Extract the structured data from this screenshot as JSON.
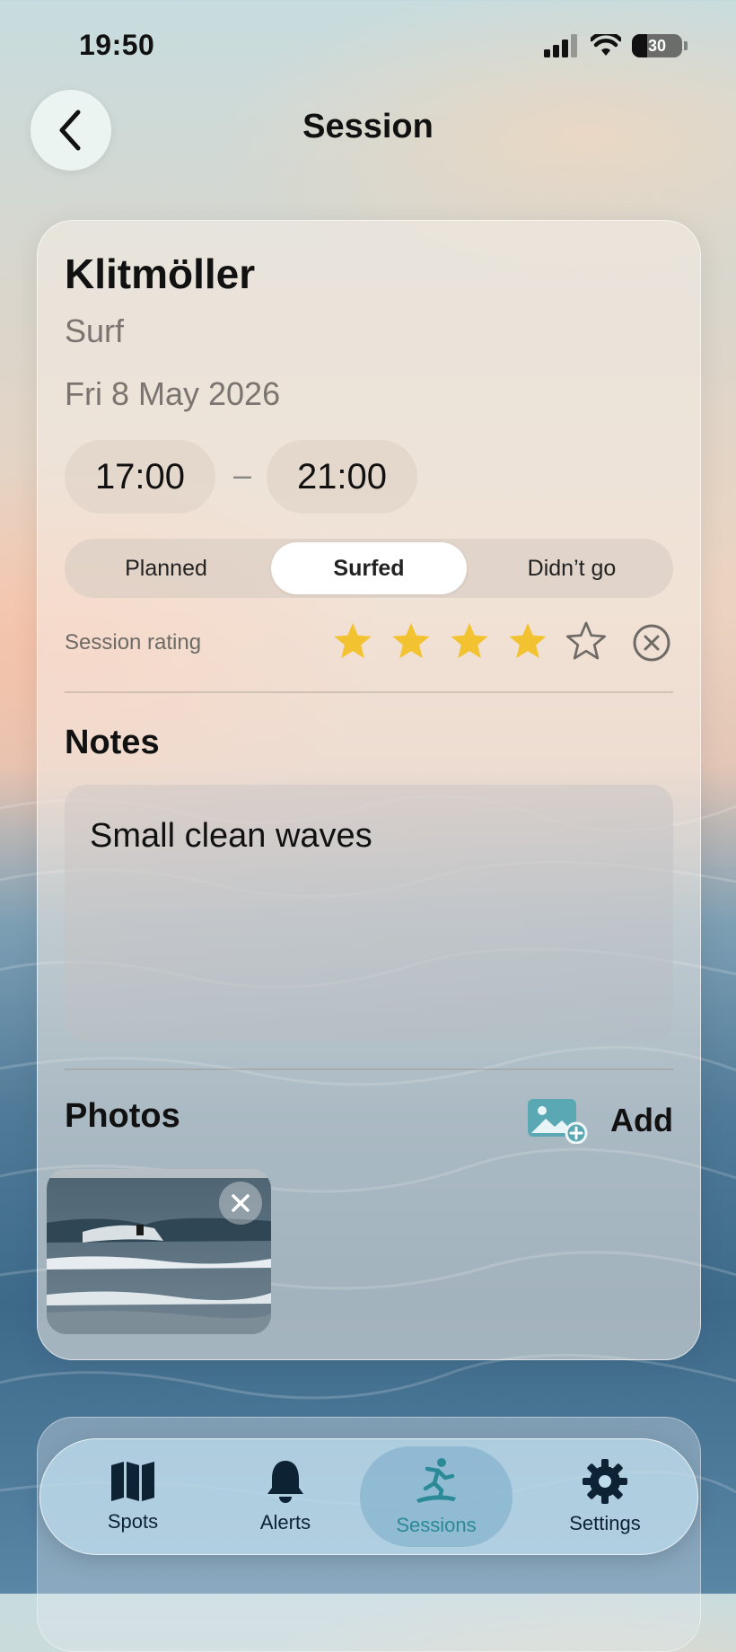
{
  "status_bar": {
    "time": "19:50",
    "battery": "30"
  },
  "nav": {
    "title": "Session"
  },
  "session": {
    "spot": "Klitmöller",
    "sport": "Surf",
    "date": "Fri 8 May 2026",
    "start_time": "17:00",
    "separator": "–",
    "end_time": "21:00",
    "status_options": [
      "Planned",
      "Surfed",
      "Didn’t go"
    ],
    "selected_status": "Surfed",
    "rating_label": "Session rating",
    "rating": 4,
    "rating_max": 5,
    "notes_heading": "Notes",
    "notes_text": "Small clean waves",
    "photos_heading": "Photos",
    "add_label": "Add"
  },
  "tabs": [
    {
      "label": "Spots",
      "icon": "map-icon"
    },
    {
      "label": "Alerts",
      "icon": "bell-icon"
    },
    {
      "label": "Sessions",
      "icon": "surfer-icon",
      "active": true
    },
    {
      "label": "Settings",
      "icon": "gear-icon"
    }
  ],
  "colors": {
    "star": "#f2c230",
    "accent": "#2a8a98",
    "tab_text": "#0d2233"
  }
}
